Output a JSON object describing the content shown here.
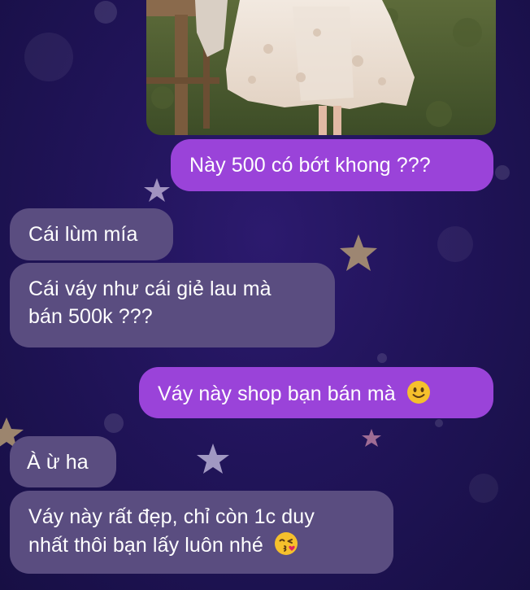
{
  "chat": {
    "messages": [
      {
        "side": "outgoing",
        "text": "Này 500 có bớt khong ???"
      },
      {
        "side": "incoming",
        "text": "Cái lùm mía"
      },
      {
        "side": "incoming",
        "text_line1": "Cái váy như cái giẻ lau mà",
        "text_line2": "bán 500k ???"
      },
      {
        "side": "outgoing",
        "text": "Váy này shop bạn bán mà",
        "emoji": "slightly-smiling-face-emoji"
      },
      {
        "side": "incoming",
        "text": "À ừ ha"
      },
      {
        "side": "incoming",
        "text_line1": "Váy này rất đẹp, chỉ còn 1c duy",
        "text_line2": "nhất thôi bạn lấy luôn nhé",
        "emoji": "kissing-face-emoji"
      }
    ]
  },
  "theme": {
    "outgoing_bubble": "#9a43d9",
    "incoming_bubble": "#5a4d80",
    "background": "#21145a"
  }
}
